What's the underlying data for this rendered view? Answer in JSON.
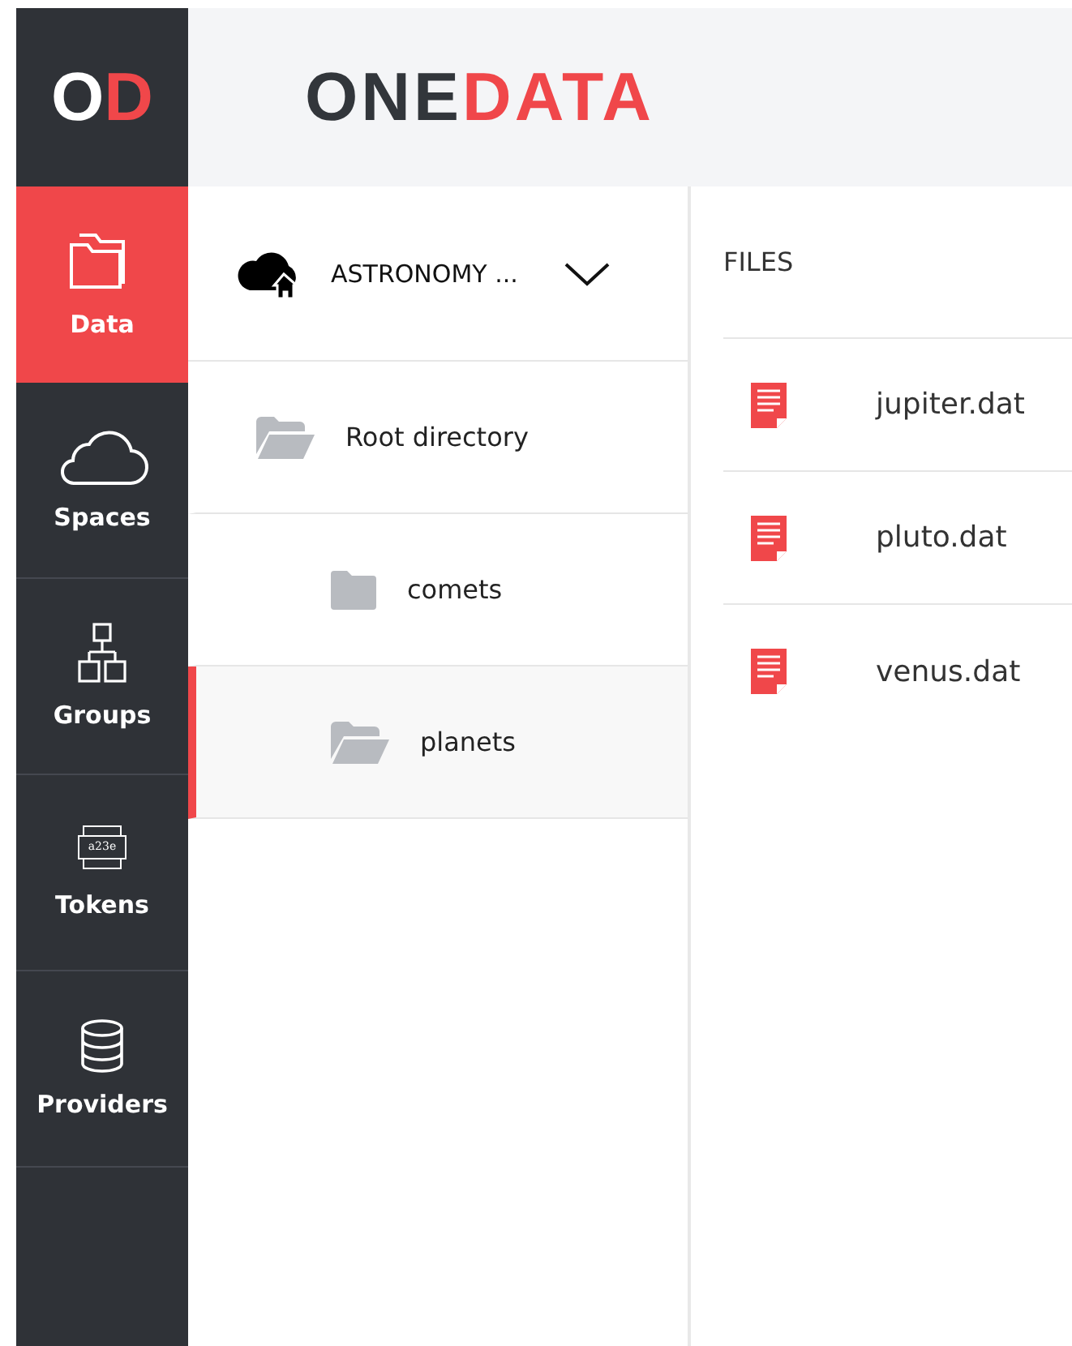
{
  "logo": [
    {
      "text": "O",
      "kind": "light"
    },
    {
      "text": "D",
      "kind": "accent"
    }
  ],
  "brand": [
    {
      "text": "ONE",
      "kind": "dark"
    },
    {
      "text": "DATA",
      "kind": "accent"
    }
  ],
  "nav": [
    {
      "label": "Data",
      "kind": "folders",
      "selected": true
    },
    {
      "label": "Spaces",
      "kind": "cloud",
      "selected": false
    },
    {
      "label": "Groups",
      "kind": "hierarchy",
      "selected": false
    },
    {
      "label": "Tokens",
      "kind": "token",
      "selected": false
    },
    {
      "label": "Providers",
      "kind": "database",
      "selected": false
    }
  ],
  "token_icon_text": "a23e",
  "space": {
    "name": "ASTRONOMY ..."
  },
  "tree": [
    {
      "name": "Root directory",
      "expanded": true,
      "selected": false,
      "children": [
        {
          "name": "comets",
          "expanded": false,
          "selected": false
        },
        {
          "name": "planets",
          "expanded": true,
          "selected": true
        }
      ]
    }
  ],
  "files": {
    "heading": "FILES",
    "items": [
      {
        "name": "jupiter.dat"
      },
      {
        "name": "pluto.dat"
      },
      {
        "name": "venus.dat"
      }
    ]
  }
}
